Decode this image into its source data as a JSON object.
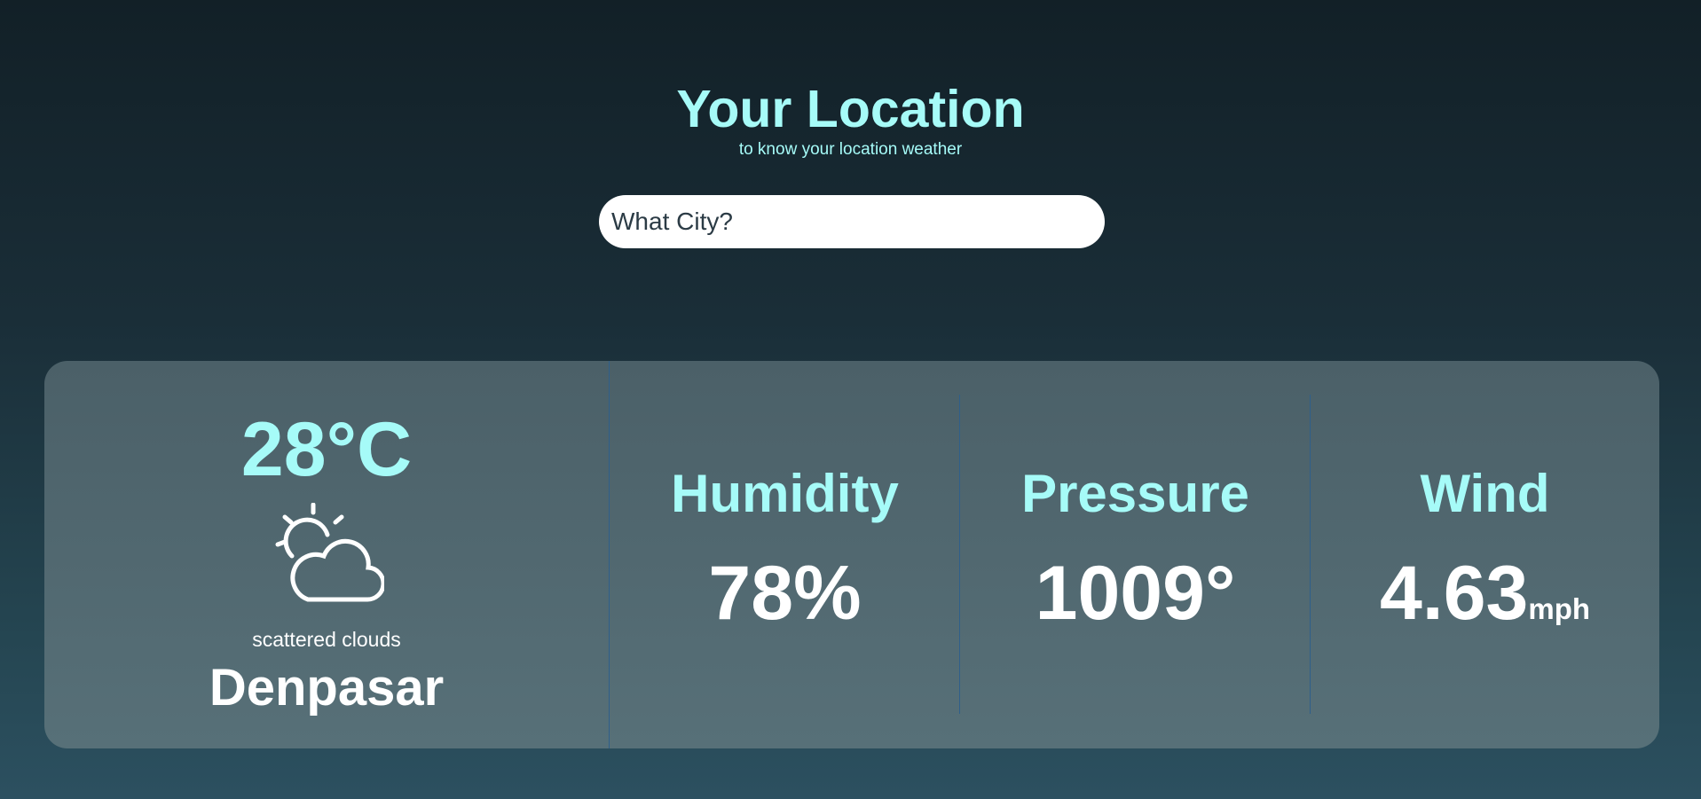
{
  "header": {
    "title": "Your Location",
    "subtitle": "to know your location weather"
  },
  "search": {
    "placeholder": "What City?"
  },
  "weather": {
    "temperature": "28°C",
    "icon": "partly-cloudy-icon",
    "description": "scattered clouds",
    "city": "Denpasar"
  },
  "stats": {
    "humidity": {
      "label": "Humidity",
      "value": "78%"
    },
    "pressure": {
      "label": "Pressure",
      "value": "1009°"
    },
    "wind": {
      "label": "Wind",
      "value": "4.63",
      "unit": "mph"
    }
  },
  "colors": {
    "accent": "#a6fbf8",
    "text": "#ffffff",
    "card": "#516870",
    "divider": "#2f5f8a"
  }
}
